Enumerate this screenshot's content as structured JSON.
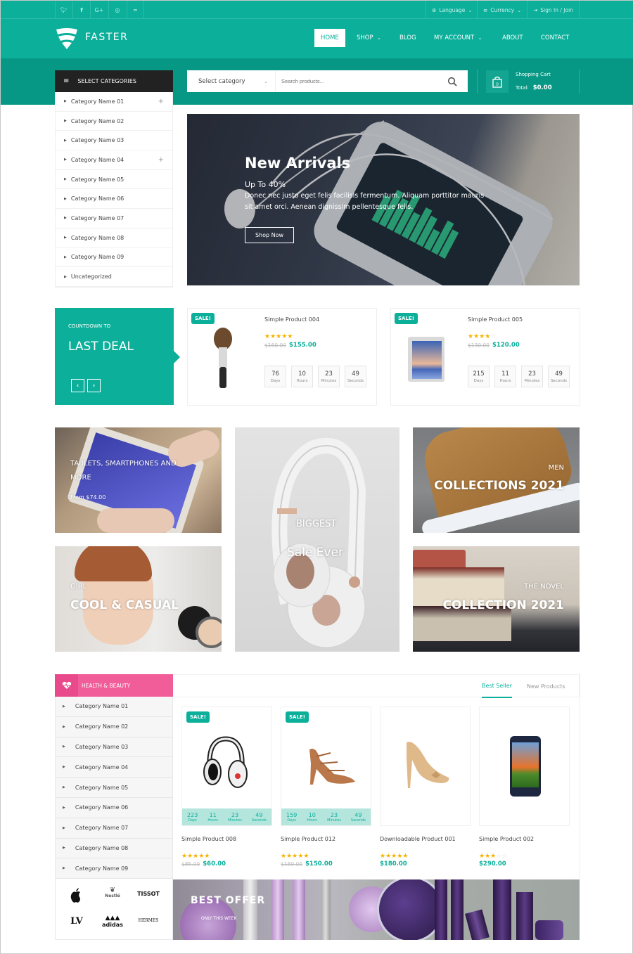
{
  "topbar": {
    "social": [
      "twitter-icon",
      "facebook-icon",
      "google-plus-icon",
      "instagram-icon",
      "rss-icon"
    ],
    "language": "Language",
    "currency": "Currency",
    "signin": "Sign In / Join"
  },
  "header": {
    "logo": "FASTER",
    "nav": [
      {
        "label": "HOME",
        "active": true,
        "dropdown": false
      },
      {
        "label": "SHOP",
        "active": false,
        "dropdown": true
      },
      {
        "label": "BLOG",
        "active": false,
        "dropdown": false
      },
      {
        "label": "MY ACCOUNT",
        "active": false,
        "dropdown": true
      },
      {
        "label": "ABOUT",
        "active": false,
        "dropdown": false
      },
      {
        "label": "CONTACT",
        "active": false,
        "dropdown": false
      }
    ]
  },
  "search": {
    "categories_title": "SELECT CATEGORIES",
    "select_value": "Select category",
    "placeholder": "Search products..."
  },
  "cart": {
    "title": "Shopping Cart",
    "total_label": "Total:",
    "total": "$0.00",
    "count": "0"
  },
  "categories": [
    {
      "label": "Category Name 01",
      "expandable": true
    },
    {
      "label": "Category Name 02",
      "expandable": false
    },
    {
      "label": "Category Name 03",
      "expandable": false
    },
    {
      "label": "Category Name 04",
      "expandable": true
    },
    {
      "label": "Category Name 05",
      "expandable": false
    },
    {
      "label": "Category Name 06",
      "expandable": false
    },
    {
      "label": "Category Name 07",
      "expandable": false
    },
    {
      "label": "Category Name 08",
      "expandable": false
    },
    {
      "label": "Category Name 09",
      "expandable": false
    },
    {
      "label": "Uncategorized",
      "expandable": false
    }
  ],
  "hero": {
    "title": "New Arrivals",
    "subtitle": "Up To 40%",
    "text1": "Donec nec justo eget felis facilisis fermentum. Aliquam porttitor mauris",
    "text2": "sit amet orci. Aenean dignissim pellentesque felis.",
    "button": "Shop Now"
  },
  "deal": {
    "kicker": "COUNTDOWN TO",
    "title": "LAST DEAL",
    "products": [
      {
        "sale": "SALE!",
        "name": "Simple Product 004",
        "rating": 5,
        "old_price": "$160.00",
        "price": "$155.00",
        "countdown": [
          {
            "n": "76",
            "l": "Days"
          },
          {
            "n": "10",
            "l": "Hours"
          },
          {
            "n": "23",
            "l": "Minutes"
          },
          {
            "n": "49",
            "l": "Seconds"
          }
        ]
      },
      {
        "sale": "SALE!",
        "name": "Simple Product 005",
        "rating": 4,
        "old_price": "$130.00",
        "price": "$120.00",
        "countdown": [
          {
            "n": "215",
            "l": "Days"
          },
          {
            "n": "11",
            "l": "Hours"
          },
          {
            "n": "23",
            "l": "Minutes"
          },
          {
            "n": "49",
            "l": "Seconds"
          }
        ]
      }
    ]
  },
  "banners": {
    "tablets": {
      "line1": "TABLETS, SMARTPHONES AND",
      "line2": "MORE",
      "price": "From $74.00"
    },
    "biggest": {
      "line1": "BIGGEST",
      "line2": "Sale Ever"
    },
    "men": {
      "kicker": "MEN",
      "title": "COLLECTIONS 2021"
    },
    "girl": {
      "kicker": "GIRL",
      "title": "COOL & CASUAL"
    },
    "novel": {
      "kicker": "THE NOVEL",
      "title": "COLLECTION 2021"
    }
  },
  "health": {
    "title": "HEALTH & BEAUTY",
    "categories": [
      "Category Name 01",
      "Category Name 02",
      "Category Name 03",
      "Category Name 04",
      "Category Name 05",
      "Category Name 06",
      "Category Name 07",
      "Category Name 08",
      "Category Name 09"
    ],
    "tabs": [
      {
        "label": "Best Seller",
        "active": true
      },
      {
        "label": "New Products",
        "active": false
      }
    ],
    "products": [
      {
        "sale": "SALE!",
        "name": "Simple Product 008",
        "rating": 5,
        "old_price": "$85.00",
        "price": "$60.00",
        "countdown": [
          {
            "n": "223",
            "l": "Days"
          },
          {
            "n": "11",
            "l": "Hours"
          },
          {
            "n": "23",
            "l": "Minutes"
          },
          {
            "n": "49",
            "l": "Seconds"
          }
        ]
      },
      {
        "sale": "SALE!",
        "name": "Simple Product 012",
        "rating": 5,
        "old_price": "$180.00",
        "price": "$150.00",
        "countdown": [
          {
            "n": "159",
            "l": "Days"
          },
          {
            "n": "10",
            "l": "Hours"
          },
          {
            "n": "23",
            "l": "Minutes"
          },
          {
            "n": "49",
            "l": "Seconds"
          }
        ]
      },
      {
        "sale": "",
        "name": "Downloadable Product 001",
        "rating": 5,
        "old_price": "",
        "price": "$180.00",
        "countdown": []
      },
      {
        "sale": "",
        "name": "Simple Product 002",
        "rating": 3,
        "old_price": "",
        "price": "$290.00",
        "countdown": []
      }
    ],
    "brands": [
      "Apple",
      "Nestlé",
      "TISSOT",
      "LV",
      "adidas",
      "HERMES"
    ],
    "offer": {
      "title": "BEST OFFER",
      "subtitle": "ONLY THIS WEEK"
    }
  },
  "colors": {
    "primary": "#0baf9a",
    "pink": "#f15d99",
    "star": "#f5b400",
    "dark": "#222222"
  }
}
